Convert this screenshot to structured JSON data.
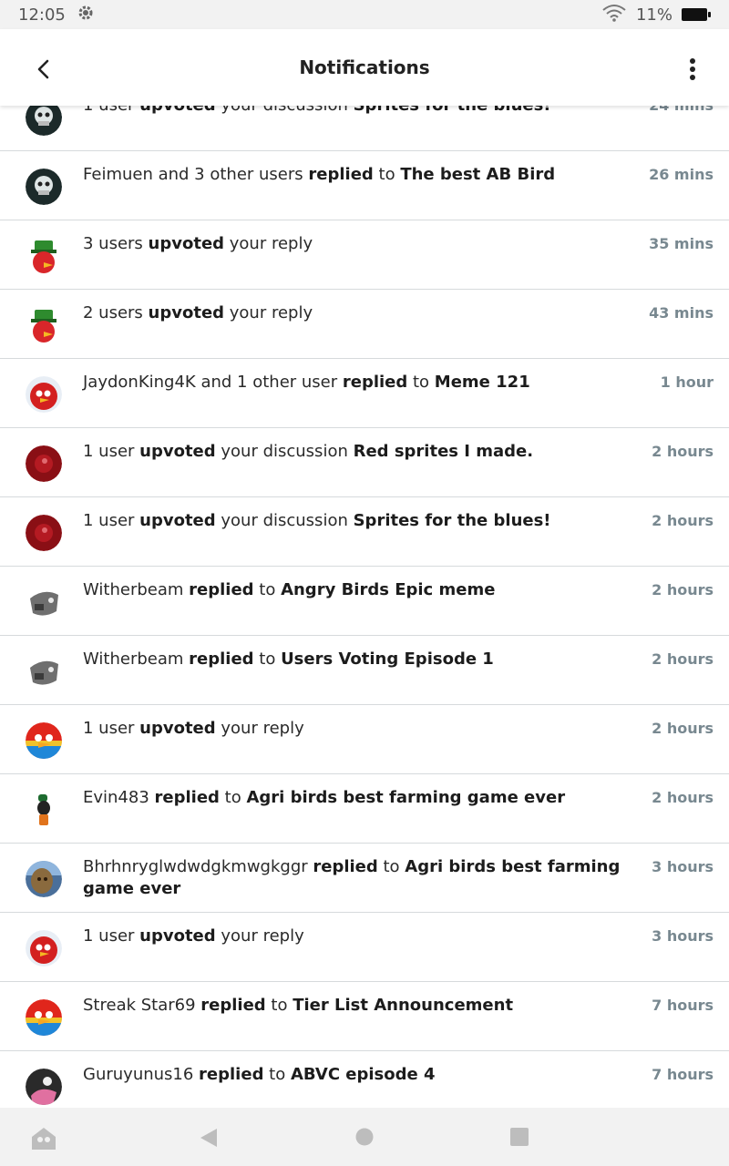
{
  "status_bar": {
    "time": "12:05",
    "battery": "11%"
  },
  "header": {
    "title": "Notifications"
  },
  "notifications": [
    {
      "parts": [
        {
          "t": "1 user ",
          "b": false
        },
        {
          "t": "upvoted",
          "b": true
        },
        {
          "t": " your discussion ",
          "b": false
        },
        {
          "t": "Sprites for the blues!",
          "b": true
        }
      ],
      "time": "24 mins",
      "avatar": "skeleton"
    },
    {
      "parts": [
        {
          "t": "Feimuen and 3 other users ",
          "b": false
        },
        {
          "t": "replied",
          "b": true
        },
        {
          "t": " to ",
          "b": false
        },
        {
          "t": "The best AB Bird",
          "b": true
        }
      ],
      "time": "26 mins",
      "avatar": "skeleton"
    },
    {
      "parts": [
        {
          "t": "3 users ",
          "b": false
        },
        {
          "t": "upvoted",
          "b": true
        },
        {
          "t": " your reply",
          "b": false
        }
      ],
      "time": "35 mins",
      "avatar": "leprechaun"
    },
    {
      "parts": [
        {
          "t": "2 users ",
          "b": false
        },
        {
          "t": "upvoted",
          "b": true
        },
        {
          "t": " your reply",
          "b": false
        }
      ],
      "time": "43 mins",
      "avatar": "leprechaun"
    },
    {
      "parts": [
        {
          "t": "JaydonKing4K and 1 other user ",
          "b": false
        },
        {
          "t": "replied",
          "b": true
        },
        {
          "t": " to ",
          "b": false
        },
        {
          "t": "Meme 121",
          "b": true
        }
      ],
      "time": "1 hour",
      "avatar": "red-bird"
    },
    {
      "parts": [
        {
          "t": "1 user ",
          "b": false
        },
        {
          "t": "upvoted",
          "b": true
        },
        {
          "t": " your discussion ",
          "b": false
        },
        {
          "t": "Red sprites I made.",
          "b": true
        }
      ],
      "time": "2 hours",
      "avatar": "dark-red"
    },
    {
      "parts": [
        {
          "t": "1 user ",
          "b": false
        },
        {
          "t": "upvoted",
          "b": true
        },
        {
          "t": " your discussion ",
          "b": false
        },
        {
          "t": "Sprites for the blues!",
          "b": true
        }
      ],
      "time": "2 hours",
      "avatar": "dark-red"
    },
    {
      "parts": [
        {
          "t": "Witherbeam ",
          "b": false
        },
        {
          "t": "replied",
          "b": true
        },
        {
          "t": " to ",
          "b": false
        },
        {
          "t": "Angry Birds Epic meme",
          "b": true
        }
      ],
      "time": "2 hours",
      "avatar": "grey-robot"
    },
    {
      "parts": [
        {
          "t": "Witherbeam ",
          "b": false
        },
        {
          "t": "replied",
          "b": true
        },
        {
          "t": " to ",
          "b": false
        },
        {
          "t": "Users Voting Episode 1",
          "b": true
        }
      ],
      "time": "2 hours",
      "avatar": "grey-robot"
    },
    {
      "parts": [
        {
          "t": "1 user ",
          "b": false
        },
        {
          "t": "upvoted",
          "b": true
        },
        {
          "t": " your reply",
          "b": false
        }
      ],
      "time": "2 hours",
      "avatar": "rainbow-bird"
    },
    {
      "parts": [
        {
          "t": "Evin483 ",
          "b": false
        },
        {
          "t": "replied",
          "b": true
        },
        {
          "t": " to ",
          "b": false
        },
        {
          "t": "Agri birds best farming game ever",
          "b": true
        }
      ],
      "time": "2 hours",
      "avatar": "goofy"
    },
    {
      "parts": [
        {
          "t": "Bhrhnryglwdwdgkmwgkggr ",
          "b": false
        },
        {
          "t": "replied",
          "b": true
        },
        {
          "t": " to ",
          "b": false
        },
        {
          "t": "Agri birds best farming game ever",
          "b": true
        }
      ],
      "time": "3 hours",
      "avatar": "photo"
    },
    {
      "parts": [
        {
          "t": "1 user ",
          "b": false
        },
        {
          "t": "upvoted",
          "b": true
        },
        {
          "t": " your reply",
          "b": false
        }
      ],
      "time": "3 hours",
      "avatar": "red-bird"
    },
    {
      "parts": [
        {
          "t": "Streak Star69 ",
          "b": false
        },
        {
          "t": "replied",
          "b": true
        },
        {
          "t": " to ",
          "b": false
        },
        {
          "t": "Tier List Announcement",
          "b": true
        }
      ],
      "time": "7 hours",
      "avatar": "rainbow-bird"
    },
    {
      "parts": [
        {
          "t": "Guruyunus16 ",
          "b": false
        },
        {
          "t": "replied",
          "b": true
        },
        {
          "t": " to ",
          "b": false
        },
        {
          "t": "ABVC episode 4",
          "b": true
        }
      ],
      "time": "7 hours",
      "avatar": "pink-bird"
    }
  ],
  "avatar_colors": {
    "skeleton": "#1c2a2a",
    "leprechaun": "#2e8b2e",
    "red-bird": "#d32020",
    "dark-red": "#8a0f15",
    "grey-robot": "#6f6f6f",
    "rainbow-bird": "#e0261c",
    "goofy": "#1d6b2f",
    "photo": "#4a6f9a",
    "pink-bird": "#e070a0"
  }
}
